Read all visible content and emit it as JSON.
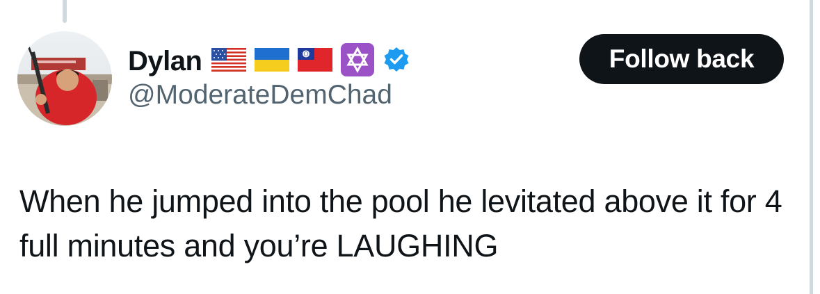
{
  "user": {
    "display_name": "Dylan",
    "handle": "@ModerateDemChad",
    "badges": [
      {
        "icon": "us-flag-icon"
      },
      {
        "icon": "ukraine-flag-icon"
      },
      {
        "icon": "taiwan-flag-icon"
      },
      {
        "icon": "star-of-david-icon"
      },
      {
        "icon": "verified-badge-icon"
      }
    ],
    "avatar_icon": "profile-photo"
  },
  "actions": {
    "follow_label": "Follow back"
  },
  "tweet": {
    "text": "When he jumped into the pool he levitated above it for 4 full minutes and you’re LAUGHING"
  },
  "colors": {
    "text_primary": "#0f1419",
    "text_secondary": "#536471",
    "button_bg": "#0f1419",
    "button_text": "#ffffff",
    "verified_blue": "#1d9bf0",
    "thread_line": "#cfd9de"
  }
}
